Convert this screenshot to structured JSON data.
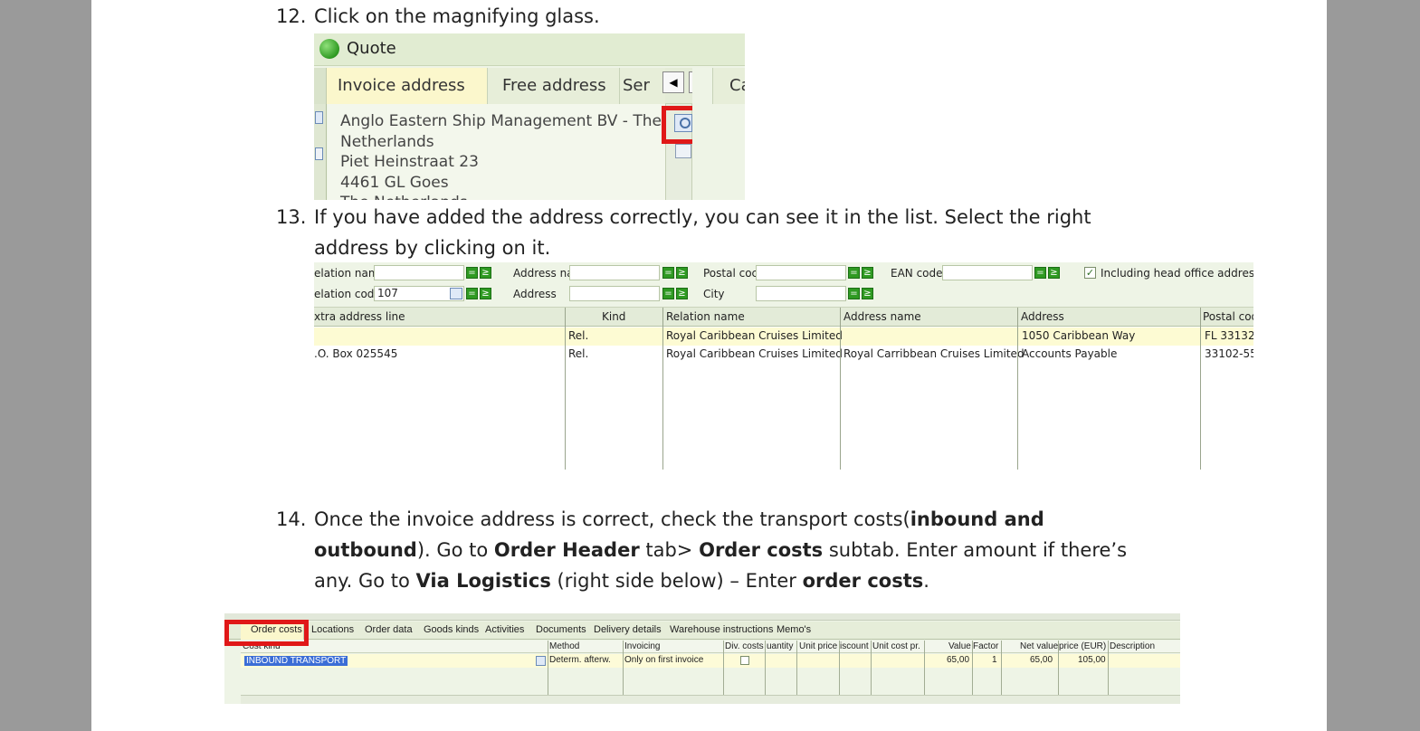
{
  "step12": {
    "num": "12.",
    "text": "Click on the magnifying glass."
  },
  "step13": {
    "num": "13.",
    "line1": "If you have added the address correctly, you can see it in the list. Select the right",
    "line2": "address by clicking on it."
  },
  "step14": {
    "num": "14.",
    "l1_a": "Once the invoice address is correct, check the transport costs(",
    "l1_b": "inbound and",
    "l2_a": "outbound",
    "l2_b": "). Go to ",
    "l2_c": "Order Header",
    "l2_d": " tab> ",
    "l2_e": "Order costs",
    "l2_f": " subtab. Enter amount if there’s",
    "l3_a": "any. Go to ",
    "l3_b": "Via Logistics",
    "l3_c": " (right side below) – Enter ",
    "l3_d": "order costs",
    "l3_e": "."
  },
  "shot1": {
    "title": "Quote",
    "tabs": [
      "Invoice address",
      "Free address",
      "Ser",
      "Ca"
    ],
    "address_lines": [
      "Anglo Eastern Ship Management BV - The",
      "Netherlands",
      "Piet Heinstraat 23",
      "4461 GL  Goes",
      "The Netherlands"
    ],
    "nav_left": "◀",
    "nav_right": "▶"
  },
  "shot2": {
    "filters": {
      "relation_name": "elation nam",
      "relation_code": "elation code",
      "relation_code_value": "107",
      "address_name": "Address nai",
      "address": "Address",
      "postal_code": "Postal coc",
      "city": "City",
      "ean_code": "EAN code",
      "include_head_office": "Including head office addresses",
      "eq": "=",
      "ge": "≥",
      "check": "✓"
    },
    "columns": [
      "xtra address line",
      "Kind",
      "Relation name",
      "Address name",
      "Address",
      "Postal cod"
    ],
    "rows": [
      [
        "",
        "Rel.",
        "Royal Caribbean Cruises Limited",
        "",
        "1050 Caribbean Way",
        "FL 33132"
      ],
      [
        ".O. Box 025545",
        "Rel.",
        "Royal Caribbean Cruises Limited",
        "Royal Carribbean Cruises Limited",
        "Accounts Payable",
        "33102-55"
      ]
    ]
  },
  "shot3": {
    "tabs": [
      "Order costs",
      "Locations",
      "Order data",
      "Goods kinds",
      "Activities",
      "Documents",
      "Delivery details",
      "Warehouse instructions",
      "Memo's"
    ],
    "columns": [
      "Cost kind",
      "Method",
      "Invoicing",
      "Div. costs",
      "uantity",
      "Unit price",
      "iscount",
      "Unit cost pr.",
      "Value",
      "Factor",
      "Net value",
      "price  (EUR)",
      "Description"
    ],
    "row": [
      "INBOUND TRANSPORT",
      "Determ. afterw.",
      "Only on first invoice",
      "",
      "",
      "",
      "",
      "",
      "65,00",
      "1",
      "65,00",
      "105,00",
      ""
    ]
  },
  "colors": {
    "highlight_red": "#e01818",
    "panel_green": "#eef4e6",
    "row_yellow": "#fdfbd8",
    "selection_blue": "#3b6dd6"
  }
}
